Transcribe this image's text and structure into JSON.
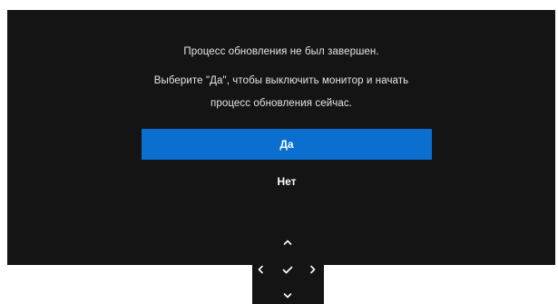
{
  "dialog": {
    "line1": "Процесс обновления не был завершен.",
    "line2": "Выберите \"Да\", чтобы выключить монитор и начать",
    "line3": "процесс обновления сейчас.",
    "yes_label": "Да",
    "no_label": "Нет"
  },
  "colors": {
    "background": "#141414",
    "selected_button": "#0a6fcf",
    "text": "#e6e6e6"
  },
  "navigation": {
    "icons": [
      "chevron-up-icon",
      "chevron-left-icon",
      "checkmark-icon",
      "chevron-right-icon",
      "chevron-down-icon"
    ]
  }
}
